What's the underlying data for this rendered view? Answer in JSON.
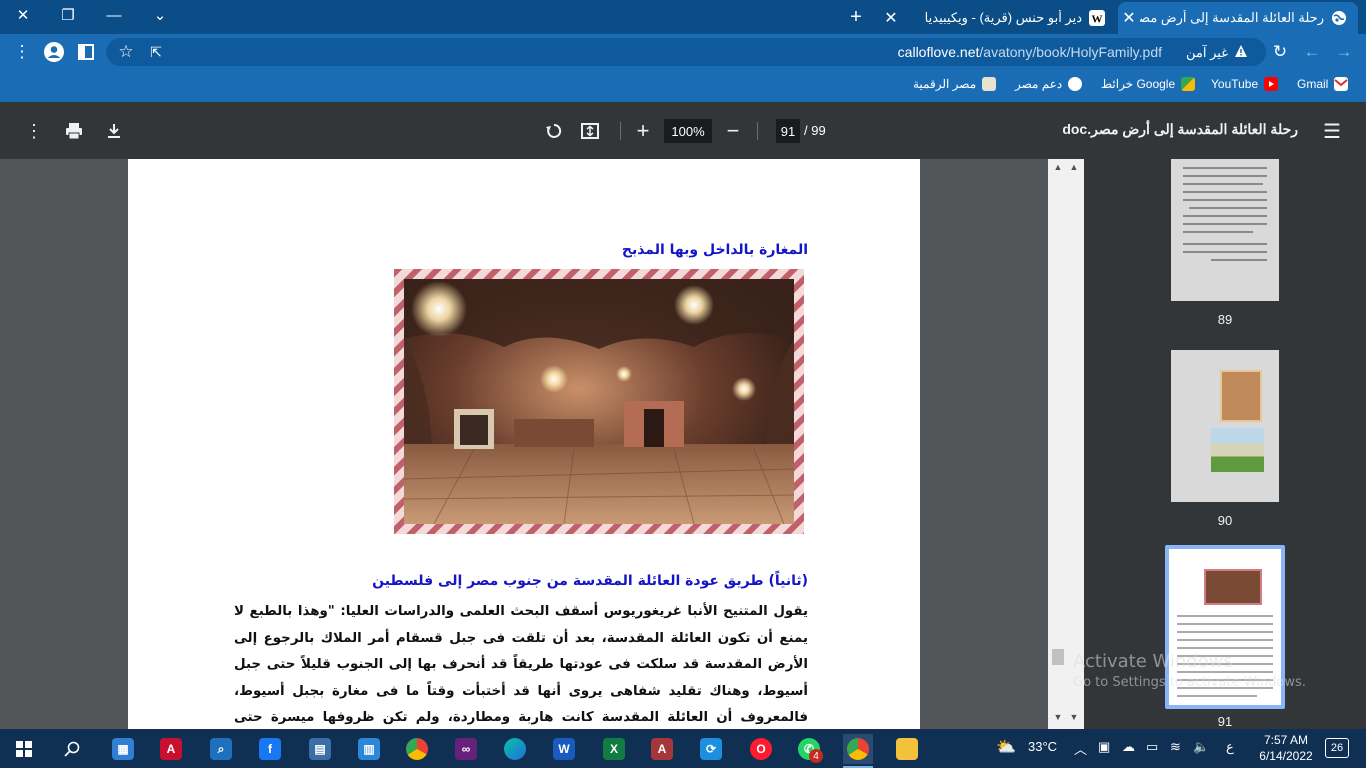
{
  "tabs": [
    {
      "title": "رحلة العائلة المقدسة إلى أرض مصر",
      "favicon": "globe-icon",
      "active": true
    },
    {
      "title": "دير أبو حنس (قرية) - ويكيبيديا",
      "favicon": "wikipedia-icon",
      "active": false
    }
  ],
  "address": {
    "security_label": "غير آمن",
    "host": "calloflove.net",
    "path": "/avatony/book/HolyFamily.pdf"
  },
  "bookmarks": [
    {
      "label": "Gmail",
      "icon": "gmail-icon",
      "color": "#d93025"
    },
    {
      "label": "YouTube",
      "icon": "youtube-icon",
      "color": "#ff0000"
    },
    {
      "label": "خرائط Google",
      "icon": "maps-icon",
      "color": "#34a853"
    },
    {
      "label": "دعم مصر",
      "icon": "globe-icon",
      "color": "#ffffff"
    },
    {
      "label": "مصر الرقمية",
      "icon": "site-icon",
      "color": "#e8e3d0"
    }
  ],
  "pdf": {
    "title": "رحلة العائلة المقدسة إلى أرض مصر.doc",
    "current_page": "91",
    "total_pages": "/ 99",
    "zoom": "100%"
  },
  "document": {
    "caption": "المغارة بالداخل وبها المذبح",
    "photo_alt": "cave-interior-photo",
    "section_heading": "(ثانياً) طريق عودة العائلة المقدسة من جنوب مصر إلى فلسطين",
    "paragraph": "يقول المتنيح الأنبا غريغوريوس أسقف البحث العلمى والدراسات العليا: \"وهذا بالطبع لا يمنع أن تكون العائلة المقدسة، بعد أن تلقت فى جبل قسقام أمر الملاك بالرجوع إلى الأرض المقدسة قد سلكت فى عودتها طريقاً قد أنحرف بها إلى الجنوب قليلاً حتى جبل أسيوط، وهناك تقليد شفاهى يروى أنها قد أختبأت وقتاً ما فى مغارة بجبل أسيوط، فالمعروف أن العائلة المقدسة كانت هاربة ومطاردة، ولم تكن ظروفها ميسرة حتى تسلك فى سيرها طريقاً ثابتاً مستقيماً، فلابد أنها عرجت على بعض أماكن"
  },
  "thumbnails": [
    {
      "label": "89"
    },
    {
      "label": "90"
    },
    {
      "label": "91",
      "selected": true
    }
  ],
  "watermark": {
    "line1": "Activate Windows",
    "line2": "Go to Settings to activate Windows."
  },
  "taskbar": {
    "weather": "33°C",
    "time": "7:57 AM",
    "date": "6/14/2022",
    "lang": "ع",
    "notifications": "26",
    "whatsapp_badge": "4"
  }
}
